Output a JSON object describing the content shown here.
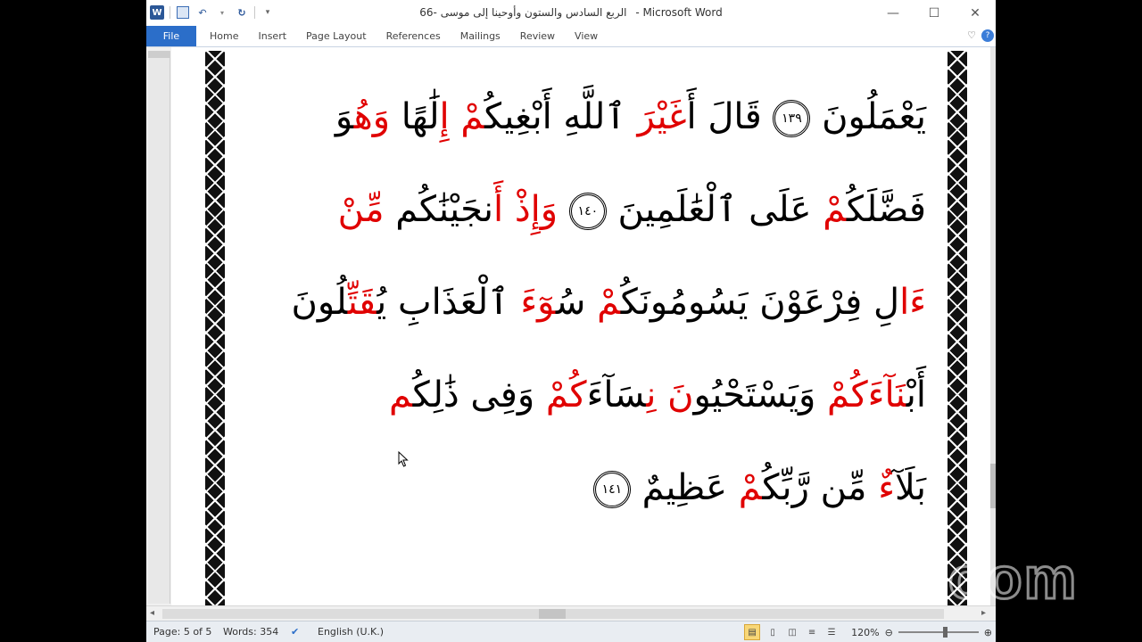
{
  "titlebar": {
    "document_name": "الربع السادس والستون وأوحينا إلى موسى -66",
    "app_name": "- Microsoft Word",
    "word_icon": "W",
    "quick_access": [
      "word-logo-icon",
      "save-icon",
      "undo-icon",
      "redo-icon",
      "customize-qat-icon"
    ],
    "controls": {
      "minimize": "—",
      "maximize": "☐",
      "close": "✕"
    }
  },
  "ribbon": {
    "file_tab": "File",
    "tabs": [
      "Home",
      "Insert",
      "Page Layout",
      "References",
      "Mailings",
      "Review",
      "View"
    ],
    "collapse_glyph": "♡",
    "help_glyph": "?"
  },
  "document": {
    "lines": [
      {
        "segments": [
          {
            "text": "يَعْمَلُونَ ",
            "red": false
          },
          {
            "text": "١٣٩",
            "ayah": true
          },
          {
            "text": " قَالَ أَ",
            "red": false
          },
          {
            "text": "غَيْرَ",
            "red": true
          },
          {
            "text": " ٱللَّهِ أَبْغِيكُ",
            "red": false
          },
          {
            "text": "مْ إِ",
            "red": true
          },
          {
            "text": "لَٰهًا ",
            "red": false
          },
          {
            "text": "وَهُ",
            "red": true
          },
          {
            "text": "وَ",
            "red": false
          }
        ]
      },
      {
        "segments": [
          {
            "text": "فَضَّلَكُ",
            "red": false
          },
          {
            "text": "مْ",
            "red": true
          },
          {
            "text": " عَلَى ٱلْعَٰلَمِينَ ",
            "red": false
          },
          {
            "text": "١٤٠",
            "ayah": true
          },
          {
            "text": " ",
            "red": false
          },
          {
            "text": "وَإِذْ أَ",
            "red": true
          },
          {
            "text": "نجَيْنَٰكُم ",
            "red": false
          },
          {
            "text": "مِّنْ",
            "red": true
          }
        ]
      },
      {
        "segments": [
          {
            "text": "ءَا",
            "red": true
          },
          {
            "text": "لِ فِرْعَوْنَ يَسُومُونَكُ",
            "red": false
          },
          {
            "text": "مْ",
            "red": true
          },
          {
            "text": " سُ",
            "red": false
          },
          {
            "text": "وٓءَ",
            "red": true
          },
          {
            "text": " ٱلْعَذَابِ يُ",
            "red": false
          },
          {
            "text": "قَتِّ",
            "red": true
          },
          {
            "text": "لُونَ",
            "red": false
          }
        ]
      },
      {
        "segments": [
          {
            "text": "أَبْ",
            "red": false
          },
          {
            "text": "نَآءَ",
            "red": true
          },
          {
            "text": "كُمْ",
            "red": true
          },
          {
            "text": " وَيَسْتَحْيُو",
            "red": false
          },
          {
            "text": "نَ نِ",
            "red": true
          },
          {
            "text": "سَآءَ",
            "red": false
          },
          {
            "text": "كُمْ",
            "red": true
          },
          {
            "text": " وَفِى ذَٰلِكُ",
            "red": false
          },
          {
            "text": "م",
            "red": true
          }
        ]
      },
      {
        "segments": [
          {
            "text": "بَلَآ",
            "red": false
          },
          {
            "text": "ءٌ",
            "red": true
          },
          {
            "text": " مِّن رَّبِّكُ",
            "red": false
          },
          {
            "text": "مْ",
            "red": true
          },
          {
            "text": " عَظِيمٌ ",
            "red": false
          },
          {
            "text": "١٤١",
            "ayah": true
          }
        ]
      }
    ]
  },
  "statusbar": {
    "page": "Page: 5 of 5",
    "words": "Words: 354",
    "language": "English (U.K.)",
    "zoom_level": "120%",
    "zoom_fraction": 0.58
  },
  "watermark": {
    "text": "zoom"
  },
  "colors": {
    "accent": "#2b6ec9",
    "quran_red": "#e00000",
    "statusbar": "#e9edf2"
  }
}
